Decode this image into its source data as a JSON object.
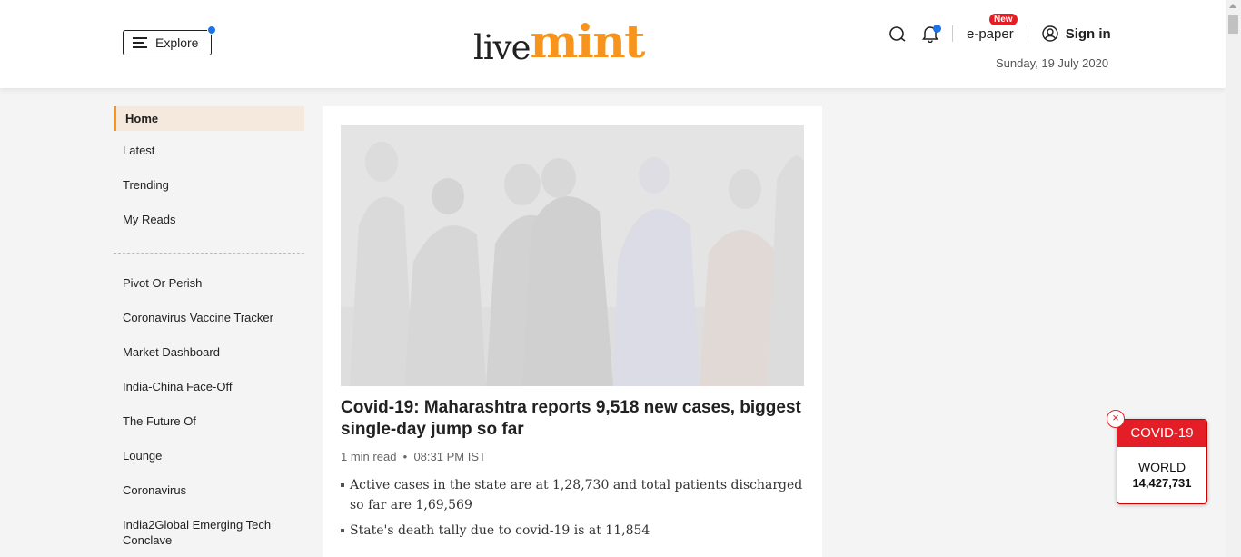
{
  "header": {
    "explore_label": "Explore",
    "logo_live": "live",
    "logo_mint": "mint",
    "epaper_label": "e-paper",
    "new_badge": "New",
    "signin_label": "Sign in",
    "date": "Sunday, 19 July 2020"
  },
  "sidebar": {
    "home": "Home",
    "primary": [
      "Latest",
      "Trending",
      "My Reads"
    ],
    "secondary": [
      "Pivot Or Perish",
      "Coronavirus Vaccine Tracker",
      "Market Dashboard",
      "India-China Face-Off",
      "The Future Of",
      "Lounge",
      "Coronavirus",
      "India2Global Emerging Tech Conclave"
    ]
  },
  "article": {
    "headline": "Covid-19: Maharashtra reports 9,518 new cases, biggest single-day jump so far",
    "read_time": "1 min read",
    "time": "08:31 PM IST",
    "bullets": [
      "Active cases in the state are at 1,28,730 and total patients discharged so far are 1,69,569",
      "State's death tally due to covid-19 is at 11,854"
    ]
  },
  "covid_widget": {
    "title": "COVID-19",
    "region": "WORLD",
    "count": "14,427,731",
    "close": "×"
  },
  "colors": {
    "accent": "#f7941d",
    "alert_red": "#e41e26",
    "notify_blue": "#1a73e8"
  }
}
